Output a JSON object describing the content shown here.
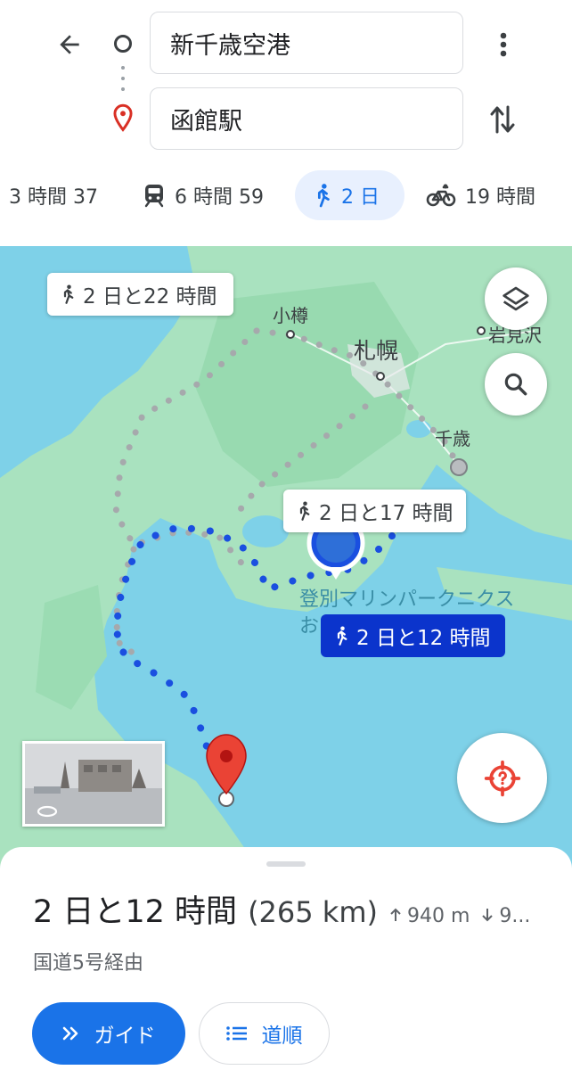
{
  "header": {
    "origin": "新千歳空港",
    "destination": "函館駅"
  },
  "modes": {
    "drive": "3 時間 37",
    "transit": "6 時間 59",
    "walk": "2 日",
    "bike": "19 時間"
  },
  "map": {
    "callouts": {
      "top": "2 日と22 時間",
      "middle": "2 日と17 時間",
      "selected": "2 日と12 時間"
    },
    "labels": {
      "otaru": "小樽",
      "sapporo": "札幌",
      "iwamizawa": "岩見沢",
      "chitose": "千歳",
      "poi": "登別マリンパークニクス",
      "poi_sub": "お"
    }
  },
  "sheet": {
    "duration": "2 日と12 時間",
    "distance": "(265 km)",
    "ascent": "940 m",
    "descent": "9...",
    "via": "国道5号経由",
    "guide_label": "ガイド",
    "steps_label": "道順"
  },
  "colors": {
    "accent": "#1a73e8",
    "route_selected": "#1a4fe0",
    "route_alt": "#a6a9ac",
    "water": "#7ed1e8",
    "land": "#a9e2bf",
    "pin": "#ea4335"
  }
}
